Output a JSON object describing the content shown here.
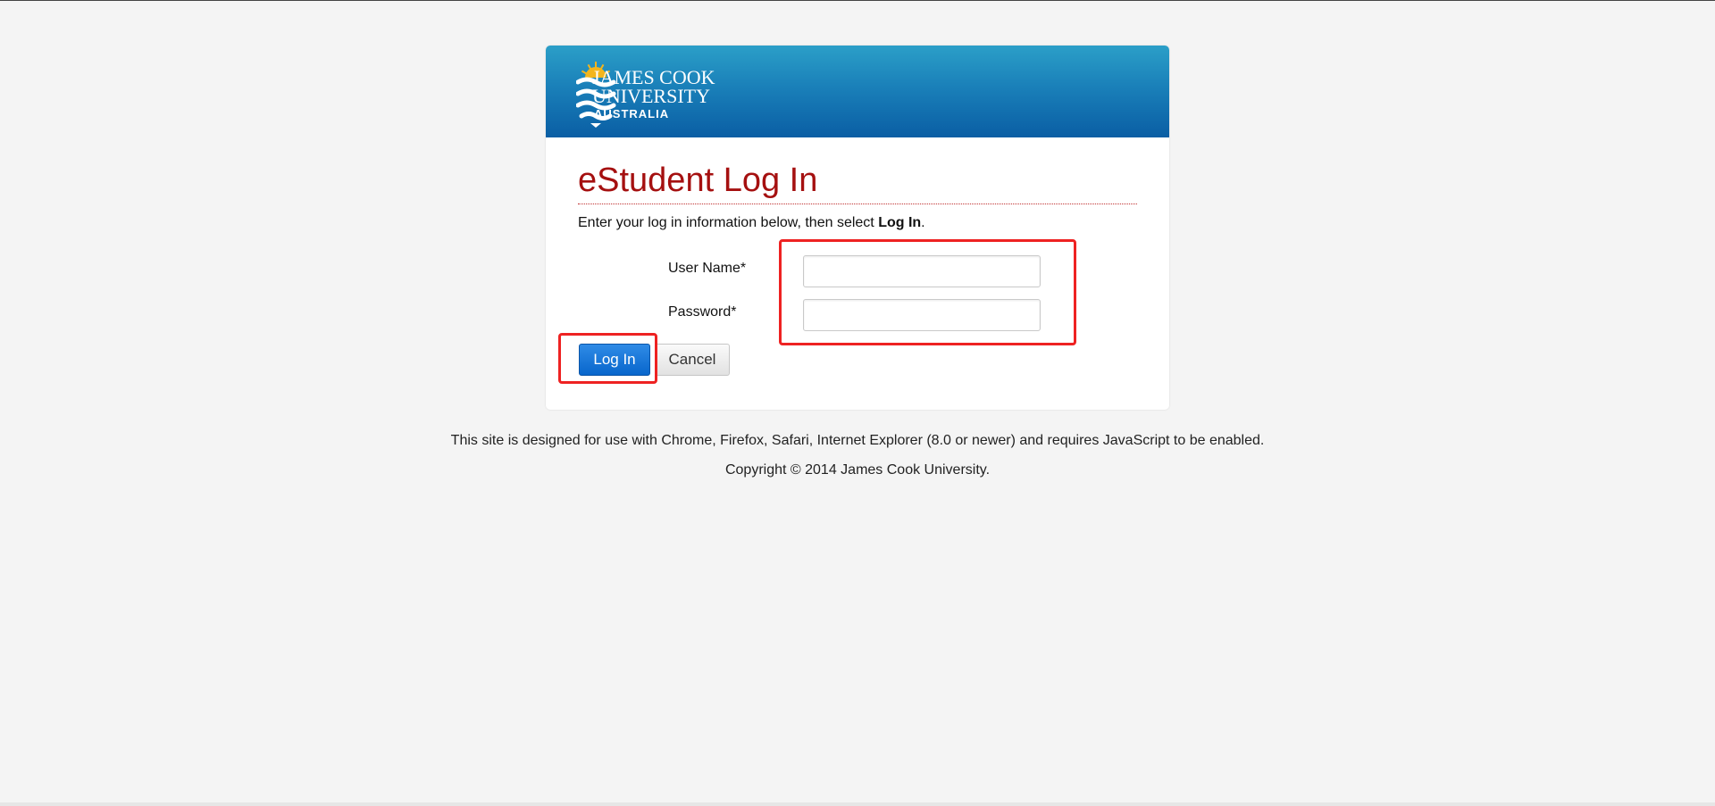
{
  "logo": {
    "line1": "JAMES COOK",
    "line2": "UNIVERSITY",
    "line3": "AUSTRALIA"
  },
  "login": {
    "title": "eStudent Log In",
    "instructions_prefix": "Enter your log in information below, then select ",
    "instructions_bold": "Log In",
    "instructions_suffix": ".",
    "username_label": "User Name*",
    "username_value": "",
    "password_label": "Password*",
    "password_value": "",
    "login_button": "Log In",
    "cancel_button": "Cancel"
  },
  "footer": {
    "browser_note": "This site is designed for use with Chrome, Firefox, Safari, Internet Explorer (8.0 or newer) and requires JavaScript to be enabled.",
    "copyright": "Copyright © 2014 James Cook University."
  },
  "colors": {
    "banner_top": "#2b9fc8",
    "banner_bottom": "#0a5ea4",
    "title": "#a51010",
    "primary_button": "#0866cc",
    "highlight": "#ee2222",
    "page_background": "#f4f4f4"
  },
  "icons": {
    "logo": "jcu-sun-waves-logo-icon"
  }
}
